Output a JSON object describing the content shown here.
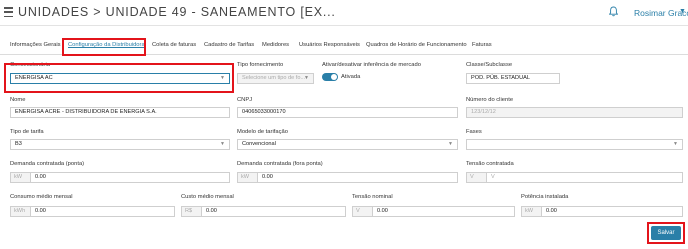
{
  "header": {
    "title": "UNIDADES > UNIDADE 49 - SANEAMENTO [EX...",
    "user": "Rosimar Graco",
    "icons": [
      "menu-icon",
      "bell-icon",
      "chevron-down-icon"
    ]
  },
  "tabs": [
    {
      "label": "Informações Gerais"
    },
    {
      "label": "Configuração da Distribuidora"
    },
    {
      "label": "Coleta de faturas"
    },
    {
      "label": "Cadastro de Tarifas"
    },
    {
      "label": "Medidores"
    },
    {
      "label": "Usuários Responsáveis"
    },
    {
      "label": "Quadros de Horário de Funcionamento"
    },
    {
      "label": "Faturas"
    }
  ],
  "form": {
    "concessionaria": {
      "label": "Concessionária",
      "value": "ENERGISA AC"
    },
    "tipo_fornecimento": {
      "label": "Tipo fornecimento",
      "placeholder": "Selecione um tipo de fo..."
    },
    "inferencia": {
      "label": "Ativar/desativar inferência de mercado",
      "status": "Ativada",
      "enabled": true
    },
    "classe": {
      "label": "Classe/Subclasse",
      "value": "POD. PÚB. ESTADUAL"
    },
    "nome": {
      "label": "Nome",
      "value": "ENERGISA ACRE - DISTRIBUIDORA DE ENERGIA S.A."
    },
    "cnpj": {
      "label": "CNPJ",
      "value": "04065033000170"
    },
    "numero_cliente": {
      "label": "Número do cliente",
      "value": "123/12/12"
    },
    "tipo_tarifa": {
      "label": "Tipo de tarifa",
      "value": "B3"
    },
    "modelo_tarifacao": {
      "label": "Modelo de tarifação",
      "value": "Convencional"
    },
    "fases": {
      "label": "Fases",
      "value": ""
    },
    "demanda_ponta": {
      "label": "Demanda contratada (ponta)",
      "unit": "kW",
      "value": "0.00"
    },
    "demanda_fora_ponta": {
      "label": "Demanda contratada (fora ponta)",
      "unit": "kW",
      "value": "0.00"
    },
    "tensao_contratada": {
      "label": "Tensão contratada",
      "unit": "V",
      "value": "V"
    },
    "consumo_medio": {
      "label": "Consumo médio mensal",
      "unit": "kWh",
      "value": "0.00"
    },
    "custo_medio": {
      "label": "Custo médio mensal",
      "unit": "R$",
      "value": "0.00"
    },
    "tensao_nominal": {
      "label": "Tensão nominal",
      "unit": "V",
      "value": "0.00"
    },
    "potencia_instalada": {
      "label": "Potência instalada",
      "unit": "kW",
      "value": "0.00"
    }
  },
  "actions": {
    "save_label": "Salvar"
  },
  "colors": {
    "accent": "#2a7fa8",
    "highlight": "#e3141b"
  }
}
